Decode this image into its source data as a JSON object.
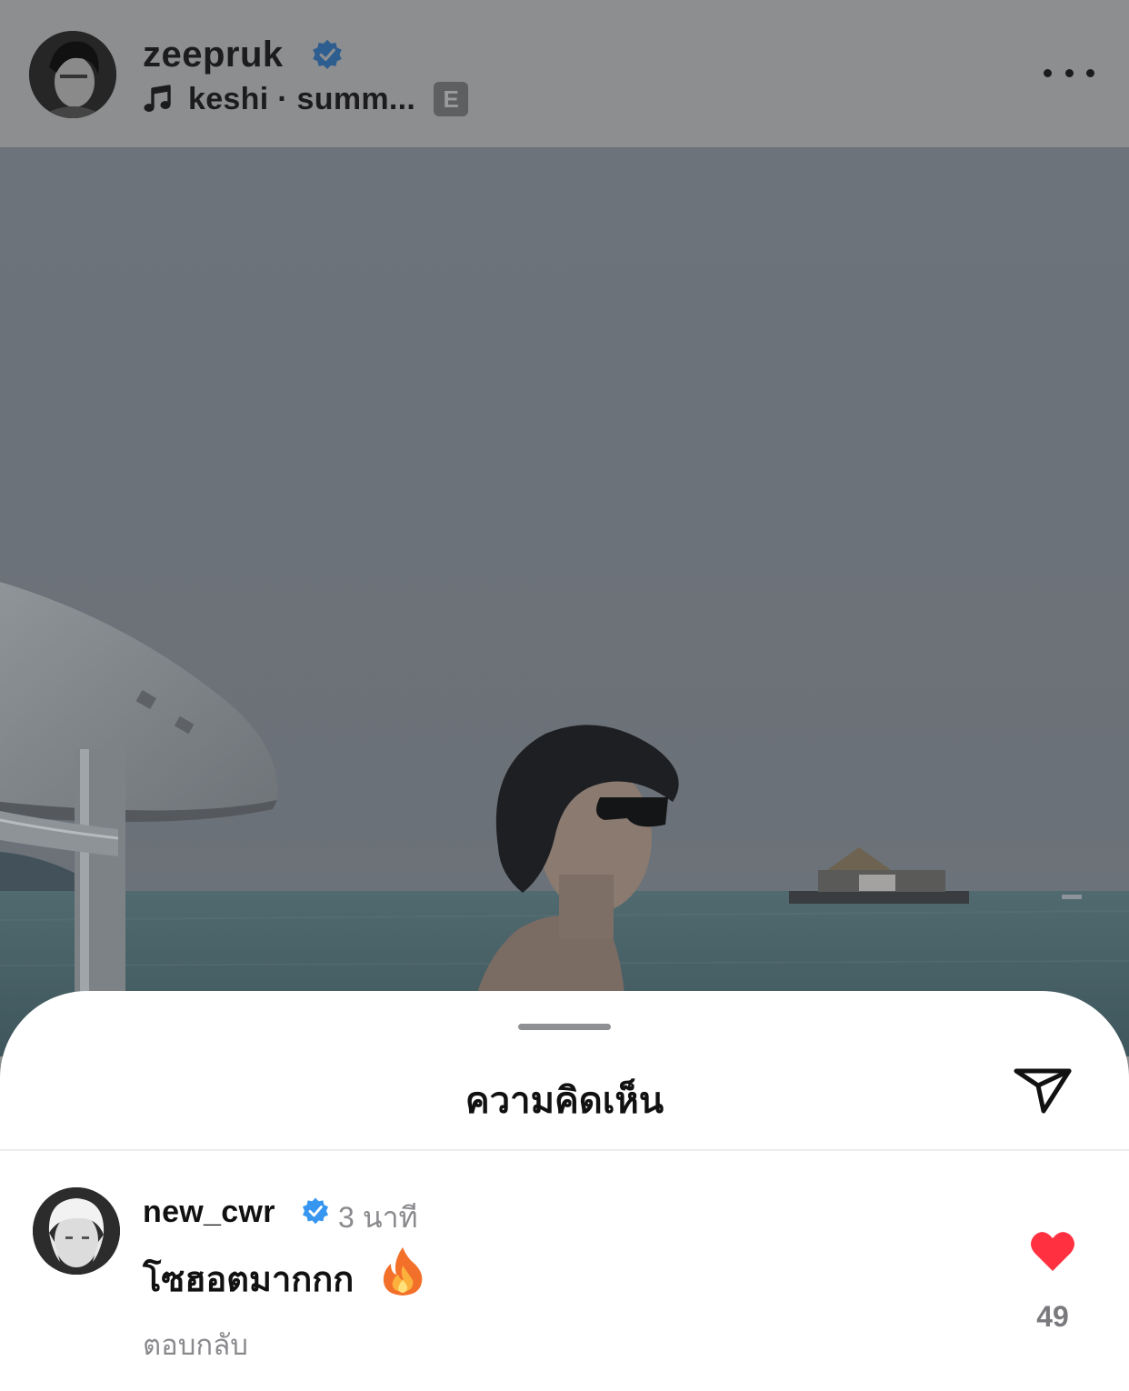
{
  "post": {
    "username": "zeepruk",
    "verified": true,
    "music": "keshi · summ...",
    "explicit_badge": "E"
  },
  "comments_sheet": {
    "title": "ความคิดเห็น",
    "comment": {
      "username": "new_cwr",
      "verified": true,
      "time": "3 นาที",
      "text": "โซฮอตมากกก",
      "like_count": "49",
      "reply_label": "ตอบกลับ"
    }
  },
  "colors": {
    "verified_blue": "#3797f0",
    "like_red": "#ff3040",
    "dim_overlay": "#8d8e90"
  },
  "icons": [
    "music-note-icon",
    "verified-badge-icon",
    "more-options-icon",
    "share-send-icon",
    "fire-emoji-icon",
    "heart-icon"
  ]
}
